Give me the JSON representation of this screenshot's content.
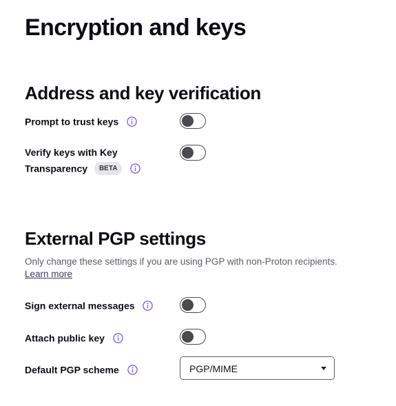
{
  "page": {
    "title": "Encryption and keys"
  },
  "verification": {
    "title": "Address and key verification",
    "prompt_trust": {
      "label": "Prompt to trust keys",
      "enabled": false
    },
    "key_transparency": {
      "label_line1": "Verify keys with Key",
      "label_line2": "Transparency",
      "badge": "BETA",
      "enabled": false
    }
  },
  "pgp": {
    "title": "External PGP settings",
    "hint": "Only change these settings if you are using PGP with non-Proton recipients.",
    "learn_more": "Learn more",
    "sign_external": {
      "label": "Sign external messages",
      "enabled": false
    },
    "attach_key": {
      "label": "Attach public key",
      "enabled": false
    },
    "scheme": {
      "label": "Default PGP scheme",
      "value": "PGP/MIME"
    }
  },
  "icons": {
    "info": "info-circle-icon",
    "caret": "caret-down-icon"
  },
  "colors": {
    "text": "#0c0c14",
    "toggle_off": "#4a4a4f",
    "info_icon": "#6d4aff",
    "hint": "#5c5c66"
  }
}
